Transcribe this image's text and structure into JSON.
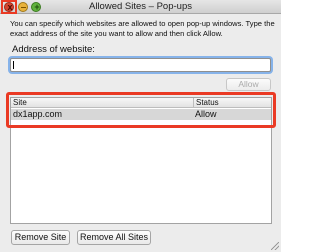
{
  "window": {
    "title": "Allowed Sites – Pop-ups",
    "close_glyph": "x",
    "zoom_glyph": "+"
  },
  "description": "You can specify which websites are allowed to open pop-up windows. Type the exact address of the site you want to allow and then click Allow.",
  "address": {
    "label": "Address of website:",
    "value": "",
    "placeholder": ""
  },
  "buttons": {
    "allow": "Allow",
    "remove_site": "Remove Site",
    "remove_all_sites": "Remove All Sites"
  },
  "table": {
    "columns": [
      "Site",
      "Status"
    ],
    "rows": [
      {
        "site": "dx1app.com",
        "status": "Allow"
      }
    ]
  },
  "colors": {
    "highlight": "#ea3a24",
    "selected_row": "#d7d7d7"
  }
}
